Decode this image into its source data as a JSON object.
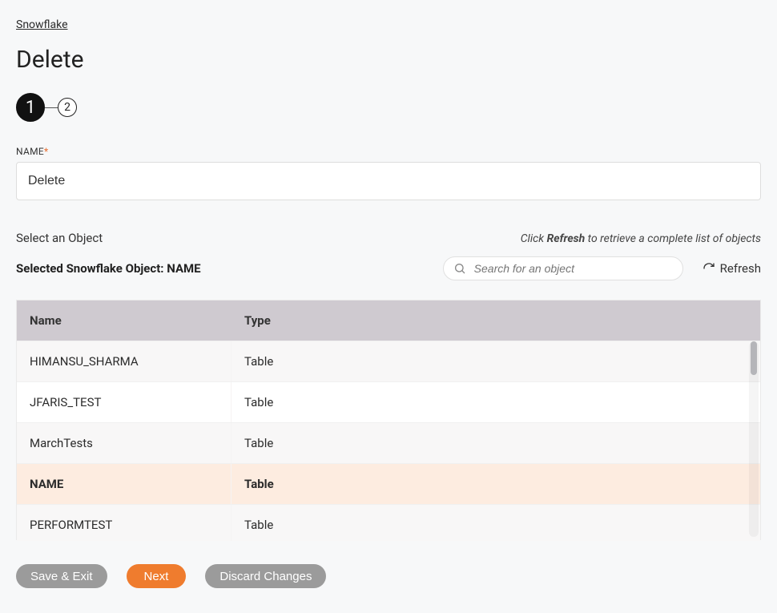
{
  "breadcrumb": "Snowflake",
  "page_title": "Delete",
  "stepper": {
    "steps": [
      "1",
      "2"
    ],
    "current": 0
  },
  "name_field": {
    "label": "NAME",
    "value": "Delete"
  },
  "select_label": "Select an Object",
  "refresh_hint_pre": "Click ",
  "refresh_hint_bold": "Refresh",
  "refresh_hint_post": " to retrieve a complete list of objects",
  "selected_label_prefix": "Selected Snowflake Object: ",
  "selected_object": "NAME",
  "search_placeholder": "Search for an object",
  "refresh_label": "Refresh",
  "columns": {
    "name": "Name",
    "type": "Type"
  },
  "rows": [
    {
      "name": "HIMANSU_SHARMA",
      "type": "Table",
      "selected": false
    },
    {
      "name": "JFARIS_TEST",
      "type": "Table",
      "selected": false
    },
    {
      "name": "MarchTests",
      "type": "Table",
      "selected": false
    },
    {
      "name": "NAME",
      "type": "Table",
      "selected": true
    },
    {
      "name": "PERFORMTEST",
      "type": "Table",
      "selected": false
    }
  ],
  "buttons": {
    "save_exit": "Save & Exit",
    "next": "Next",
    "discard": "Discard Changes"
  }
}
